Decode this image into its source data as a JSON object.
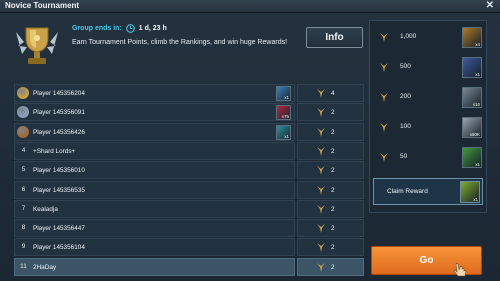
{
  "window": {
    "title": "Novice Tournament"
  },
  "header": {
    "group_label": "Group ends in:",
    "group_time": "1 d, 23 h",
    "headline": "Earn Tournament Points, climb the Rankings, and win huge Rewards!",
    "info_label": "Info"
  },
  "ranking": [
    {
      "rank": "1",
      "name": "Player 145356204",
      "points": "4",
      "medal": "#c8a13e",
      "reward": {
        "icon": "blue-crystal-icon",
        "qty": "x1",
        "color": "#3f7fb8"
      }
    },
    {
      "rank": "2",
      "name": "Player 145356091",
      "points": "2",
      "medal": "#8d9fb8",
      "reward": {
        "icon": "red-gem-icon",
        "qty": "x75",
        "color": "#b3273b"
      }
    },
    {
      "rank": "3",
      "name": "Player 145356426",
      "points": "2",
      "medal": "#a56a3a",
      "reward": {
        "icon": "teal-shard-icon",
        "qty": "x1",
        "color": "#2e8f9d"
      }
    },
    {
      "rank": "4",
      "name": "+Shard Lords+",
      "points": "2"
    },
    {
      "rank": "5",
      "name": "Player 145356010",
      "points": "2"
    },
    {
      "rank": "6",
      "name": "Player 145356535",
      "points": "2"
    },
    {
      "rank": "7",
      "name": "Kealadja",
      "points": "2"
    },
    {
      "rank": "8",
      "name": "Player 145356447",
      "points": "2"
    },
    {
      "rank": "9",
      "name": "Player 145356104",
      "points": "2"
    },
    {
      "rank": "11",
      "name": "2HaDay",
      "points": "2",
      "highlight": true
    }
  ],
  "rewards": {
    "tiers": [
      {
        "points": "1,000",
        "item": "treasure-chest-icon",
        "qty": "x4",
        "color": "#b07a2a"
      },
      {
        "points": "500",
        "item": "champion-portrait-icon",
        "qty": "x1",
        "color": "#3d5aa0"
      },
      {
        "points": "200",
        "item": "silver-chest-icon",
        "qty": "x10",
        "color": "#7b8a96"
      },
      {
        "points": "100",
        "item": "silver-coins-icon",
        "qty": "x50K",
        "color": "#9aa6b0"
      },
      {
        "points": "50",
        "item": "green-potion-icon",
        "qty": "x1",
        "color": "#3f9b3c"
      }
    ],
    "claim": {
      "label": "Claim Reward",
      "item": "potion-icon",
      "qty": "x1",
      "color": "#7fae2e"
    }
  },
  "go_label": "Go"
}
